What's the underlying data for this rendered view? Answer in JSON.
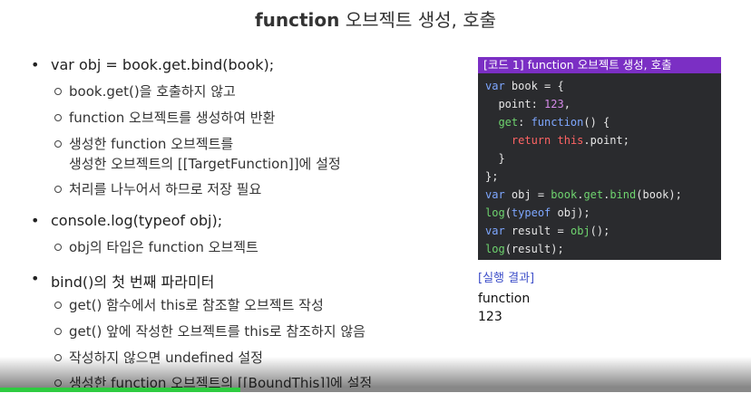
{
  "slide": {
    "title_bold": "function",
    "title_rest": " 오브젝트 생성, 호출"
  },
  "bullets": [
    {
      "text": "var obj = book.get.bind(book);",
      "subs": [
        "book.get()을 호출하지 않고",
        "function 오브젝트를 생성하여 반환",
        "생성한 function 오브젝트를",
        "생성한 오브젝트의 [[TargetFunction]]에 설정",
        "처리를 나누어서 하므로 저장 필요"
      ]
    },
    {
      "text": "console.log(typeof obj);",
      "subs": [
        "obj의 타입은 function 오브젝트"
      ]
    },
    {
      "text": "bind()의 첫 번째 파라미터",
      "subs": [
        "get() 함수에서 this로 참조할 오브젝트 작성",
        "get() 앞에 작성한 오브젝트를 this로 참조하지 않음",
        "작성하지 않으면 undefined 설정",
        "생성한 function 오브젝트의 [[BoundThis]]에 설정"
      ]
    }
  ],
  "code_box": {
    "header": "[코드 1] function 오브젝트 생성, 호출",
    "tokens": {
      "var": "var",
      "book": "book",
      "eq_open": " = {",
      "point_key": "  point",
      "colon": ": ",
      "num": "123",
      "comma": ",",
      "get_key": "  get",
      "function_kw": "function",
      "fn_open": "() {",
      "ret_indent": "    ",
      "return_kw": "return",
      "this_kw": "this",
      "point_tail": ".point;",
      "close_inner": "  }",
      "close_outer": "};",
      "obj": "obj",
      "assign": " = ",
      "book_ref": "book",
      "dot": ".",
      "get_ref": "get",
      "bind_ref": "bind",
      "bind_args": "(book);",
      "log": "log",
      "paren_open": "(",
      "typeof_kw": "typeof",
      "typeof_args": " obj);",
      "result": "result",
      "obj_call": "obj",
      "call_tail": "();",
      "log_result": "(result);"
    }
  },
  "execution": {
    "label": "[실행 결과]",
    "lines": [
      "function",
      "123"
    ]
  },
  "video": {
    "progress_fraction": 0.32,
    "colors": {
      "progress": "#2ecc40",
      "track": "#888888"
    }
  }
}
